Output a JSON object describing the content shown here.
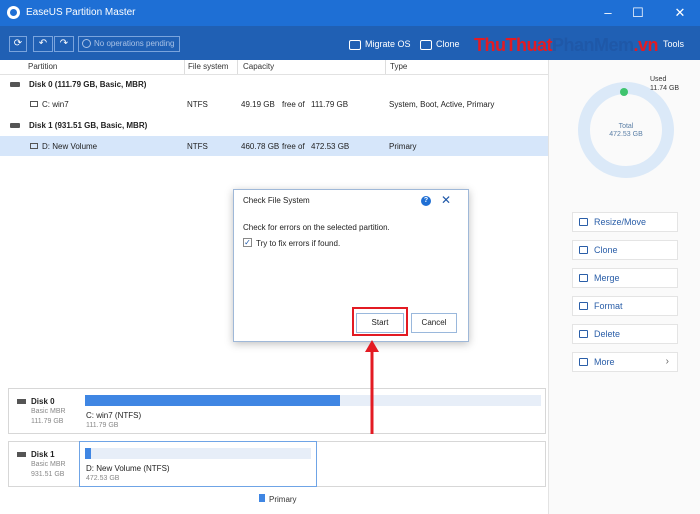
{
  "app": {
    "title": "EaseUS Partition Master"
  },
  "toolbar": {
    "pending": "No operations pending",
    "migrate_os": "Migrate OS",
    "clone": "Clone",
    "tools": "Tools"
  },
  "watermark": {
    "part1": "ThuThuat",
    "part2": "PhanMem",
    "part3": ".vn"
  },
  "table": {
    "headers": [
      "Partition",
      "File system",
      "Capacity",
      "Type"
    ],
    "free_of": "free of",
    "disks": [
      {
        "label": "Disk 0 (111.79 GB, Basic, MBR)",
        "partitions": [
          {
            "name": "C: win7",
            "fs": "NTFS",
            "free": "49.19 GB",
            "total": "111.79 GB",
            "type": "System, Boot, Active, Primary"
          }
        ]
      },
      {
        "label": "Disk 1 (931.51 GB, Basic, MBR)",
        "partitions": [
          {
            "name": "D: New Volume",
            "fs": "NTFS",
            "free": "460.78 GB",
            "total": "472.53 GB",
            "type": "Primary"
          }
        ]
      }
    ]
  },
  "usage": {
    "used_label": "Used",
    "used_value": "11.74 GB",
    "total_label": "Total",
    "total_value": "472.53 GB",
    "used_fraction": 0.025
  },
  "actions": [
    "Resize/Move",
    "Clone",
    "Merge",
    "Format",
    "Delete",
    "More"
  ],
  "diskmap": [
    {
      "name": "Disk 0",
      "type": "Basic MBR",
      "size": "111.79 GB",
      "partition": "C: win7 (NTFS)",
      "psize": "111.79 GB",
      "fill": 0.56
    },
    {
      "name": "Disk 1",
      "type": "Basic MBR",
      "size": "931.51 GB",
      "partition": "D: New Volume (NTFS)",
      "psize": "472.53 GB",
      "fill": 0.025
    }
  ],
  "legend": {
    "primary": "Primary"
  },
  "dialog": {
    "title": "Check File System",
    "message": "Check for errors on the selected partition.",
    "checkbox_label": "Try to fix errors if found.",
    "checkbox_checked": true,
    "start": "Start",
    "cancel": "Cancel"
  },
  "colors": {
    "titlebar": "#1e6fd5",
    "toolbar": "#2060b4",
    "accent": "#3f86e3",
    "highlight": "#e31b23",
    "selected_row": "#d6e6fa"
  }
}
